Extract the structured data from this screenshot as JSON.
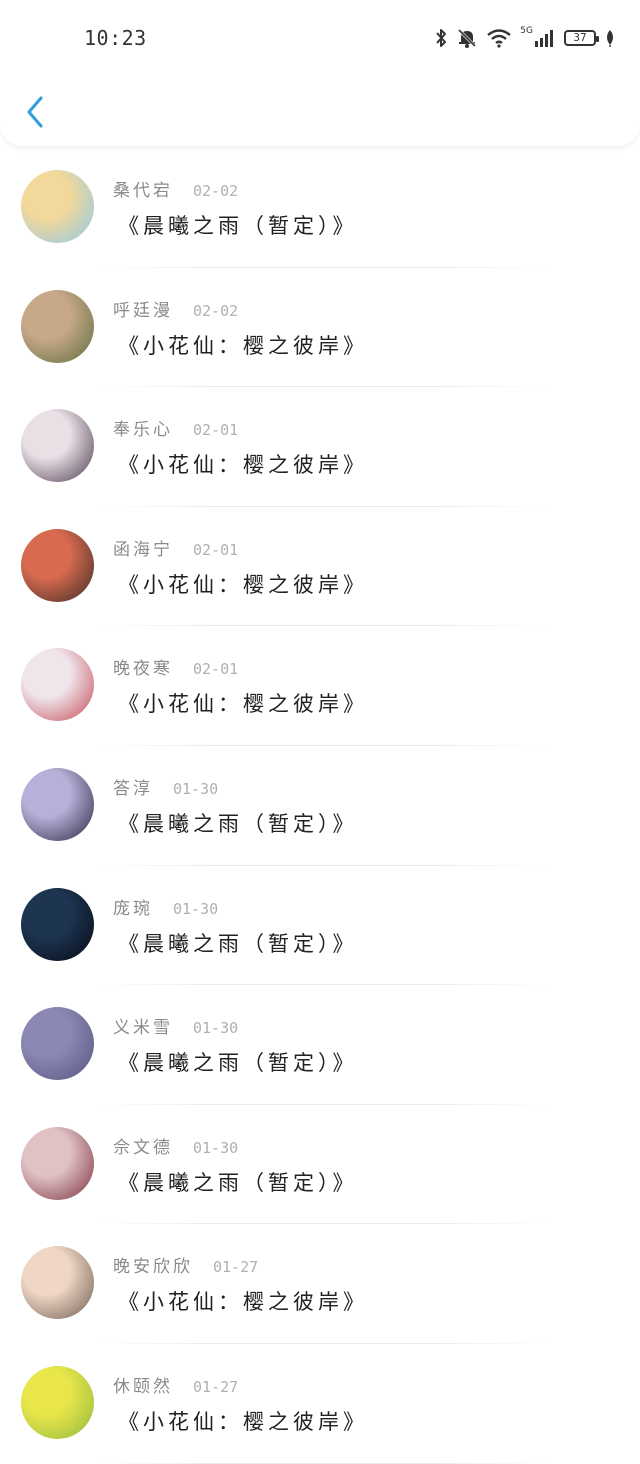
{
  "status_bar": {
    "time": "10:23",
    "network": "5G",
    "battery": "37",
    "icons": [
      "bluetooth-icon",
      "bell-off-icon",
      "wifi-icon",
      "signal-icon",
      "battery-icon",
      "leaf-icon"
    ]
  },
  "header": {
    "back_icon": "chevron-left-icon",
    "accent_color": "#2f9be0"
  },
  "list": [
    {
      "name": "桑代宕",
      "date": "02-02",
      "title": "《晨曦之雨（暂定）》",
      "avatar_colors": [
        "#f2d89a",
        "#8ec9ea"
      ]
    },
    {
      "name": "呼廷漫",
      "date": "02-02",
      "title": "《小花仙：樱之彼岸》",
      "avatar_colors": [
        "#c7a98a",
        "#5f6b3d"
      ]
    },
    {
      "name": "奉乐心",
      "date": "02-01",
      "title": "《小花仙：樱之彼岸》",
      "avatar_colors": [
        "#e9e0e6",
        "#4b3a4d"
      ]
    },
    {
      "name": "函海宁",
      "date": "02-01",
      "title": "《小花仙：樱之彼岸》",
      "avatar_colors": [
        "#d86b4f",
        "#3b2a26"
      ]
    },
    {
      "name": "晚夜寒",
      "date": "02-01",
      "title": "《小花仙：樱之彼岸》",
      "avatar_colors": [
        "#efe6ec",
        "#c44a55"
      ]
    },
    {
      "name": "答淳",
      "date": "01-30",
      "title": "《晨曦之雨（暂定）》",
      "avatar_colors": [
        "#b7b1d9",
        "#2b2540"
      ]
    },
    {
      "name": "庞琬",
      "date": "01-30",
      "title": "《晨曦之雨（暂定）》",
      "avatar_colors": [
        "#1e3552",
        "#050a12"
      ]
    },
    {
      "name": "义米雪",
      "date": "01-30",
      "title": "《晨曦之雨（暂定）》",
      "avatar_colors": [
        "#8b88b3",
        "#57537f"
      ]
    },
    {
      "name": "佘文德",
      "date": "01-30",
      "title": "《晨曦之雨（暂定）》",
      "avatar_colors": [
        "#e0c2c4",
        "#7a2f3f"
      ]
    },
    {
      "name": "晚安欣欣",
      "date": "01-27",
      "title": "《小花仙：樱之彼岸》",
      "avatar_colors": [
        "#f0d6c4",
        "#6b5a4f"
      ]
    },
    {
      "name": "休颐然",
      "date": "01-27",
      "title": "《小花仙：樱之彼岸》",
      "avatar_colors": [
        "#e8e64a",
        "#8fb83f"
      ]
    }
  ]
}
